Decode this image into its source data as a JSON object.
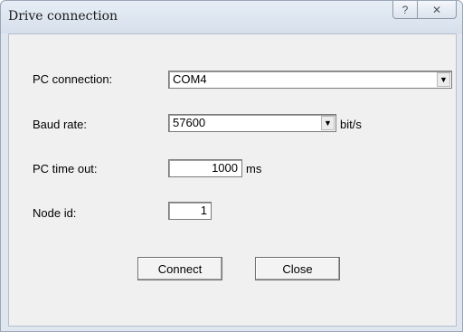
{
  "window": {
    "title": "Drive connection",
    "help_icon": "?",
    "close_icon": "✕"
  },
  "form": {
    "pc_connection": {
      "label": "PC connection:",
      "value": "COM4"
    },
    "baud_rate": {
      "label": "Baud rate:",
      "value": "57600",
      "unit": "bit/s"
    },
    "pc_time_out": {
      "label": "PC time out:",
      "value": "1000",
      "unit": "ms"
    },
    "node_id": {
      "label": "Node id:",
      "value": "1"
    }
  },
  "buttons": {
    "connect": "Connect",
    "close": "Close"
  },
  "icons": {
    "dropdown": "chevron-down-icon",
    "help": "help-icon",
    "close": "close-icon"
  }
}
